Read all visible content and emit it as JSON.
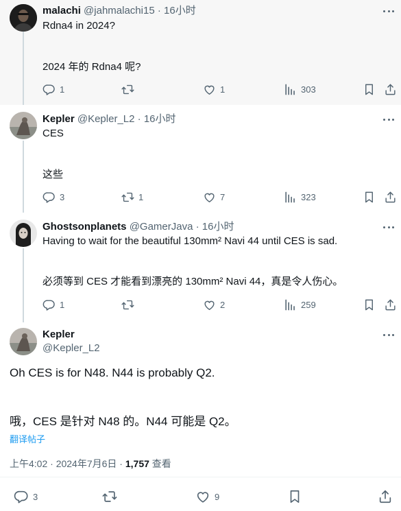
{
  "posts": [
    {
      "name": "malachi",
      "handle": "@jahmalachi15",
      "time": "16小时",
      "lines": [
        "Rdna4 in 2024?",
        "2024 年的 Rdna4 呢?"
      ],
      "replies": "1",
      "reposts": "",
      "likes": "1",
      "views": "303"
    },
    {
      "name": "Kepler",
      "handle": "@Kepler_L2",
      "time": "16小时",
      "lines": [
        "CES",
        "这些"
      ],
      "replies": "3",
      "reposts": "1",
      "likes": "7",
      "views": "323"
    },
    {
      "name": "Ghostsonplanets",
      "handle": "@GamerJava",
      "time": "16小时",
      "lines": [
        "Having to wait for the beautiful 130mm² Navi 44 until CES is sad.",
        "必须等到 CES 才能看到漂亮的 130mm² Navi 44，真是令人伤心。"
      ],
      "replies": "1",
      "reposts": "",
      "likes": "2",
      "views": "259"
    }
  ],
  "main": {
    "name": "Kepler",
    "handle": "@Kepler_L2",
    "lines": [
      "Oh CES is for N48. N44 is probably Q2.",
      "哦，CES 是针对 N48 的。N44 可能是 Q2。"
    ],
    "translate": "翻译帖子",
    "timestamp": "上午4:02 · 2024年7月6日 · ",
    "views_count": "1,757",
    "views_label": " 查看",
    "replies": "3",
    "likes": "9"
  },
  "separator": "·",
  "icons": {
    "reply": "reply-icon",
    "repost": "repost-icon",
    "like": "like-icon",
    "views": "views-icon",
    "bookmark": "bookmark-icon",
    "share": "share-icon",
    "more": "more-icon"
  },
  "colors": {
    "text": "#0f1419",
    "secondary": "#536471",
    "link": "#1d9bf0",
    "thread_line": "#cfd9de",
    "highlight_bg": "#f7f7f7"
  }
}
